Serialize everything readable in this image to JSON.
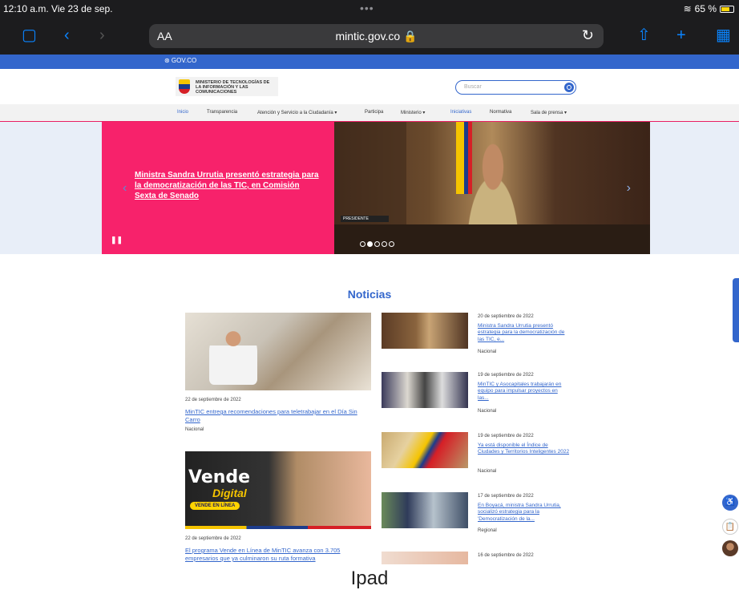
{
  "status_bar": {
    "time": "12:10 a.m.  Vie 23 de sep.",
    "center": "•••",
    "battery": "65 %"
  },
  "safari": {
    "aa": "AA",
    "url": "mintic.gov.co 🔒",
    "icons": [
      "sidebar-icon",
      "back-icon",
      "forward-icon",
      "reload-icon",
      "share-icon",
      "add-tab-icon",
      "tabs-icon"
    ]
  },
  "gov_bar": {
    "label": "⊛ GOV.CO"
  },
  "header": {
    "logo_text": "MINISTERIO DE TECNOLOGÍAS DE LA INFORMACIÓN Y LAS COMUNICACIONES",
    "search_placeholder": "Buscar"
  },
  "nav": [
    "Inicio",
    "Transparencia",
    "Atención y Servicio a la Ciudadanía ▾",
    "Participa",
    "Ministerio ▾",
    "Iniciativas",
    "Normativa",
    "Sala de prensa ▾"
  ],
  "hero": {
    "headline": "Ministra Sandra Urrutia presentó estrategia para la democratización de las TIC, en Comisión Sexta de Senado",
    "plate": "PRESIDENTE",
    "pause": "❚❚",
    "prev": "‹",
    "next": "›"
  },
  "noticias": {
    "title": "Noticias",
    "main": [
      {
        "date": "22 de septiembre de 2022",
        "title": "MinTIC entrega recomendaciones para teletrabajar en el Día Sin Carro",
        "category": "Nacional"
      },
      {
        "date": "22 de septiembre de 2022",
        "title": "El programa Vende en Línea de MinTIC avanza con 3.705 empresarios que ya culminaron su ruta formativa",
        "category": ""
      }
    ],
    "vende": {
      "line1": "Vende",
      "line2": "Digital",
      "line3": "VENDE EN LÍNEA"
    },
    "side": [
      {
        "date": "20 de septiembre de 2022",
        "title": "Ministra Sandra Urrutia presentó estrategia para la democratización de las TIC, e...",
        "category": "Nacional"
      },
      {
        "date": "19 de septiembre de 2022",
        "title": "MinTIC y Asocapitales trabajarán en equipo para impulsar proyectos en las...",
        "category": "Nacional"
      },
      {
        "date": "19 de septiembre de 2022",
        "title": "Ya está disponible el Índice de Ciudades y Territorios Inteligentes 2022",
        "category": "Nacional"
      },
      {
        "date": "17 de septiembre de 2022",
        "title": "En Boyacá, ministra Sandra Urrutia, socializó estrategia para la 'Democratización de la...",
        "category": "Regional"
      },
      {
        "date": "16 de septiembre de 2022",
        "title": "",
        "category": ""
      }
    ]
  },
  "caption": "Ipad",
  "fab": {
    "accessibility": "♿",
    "clipboard": "📋"
  }
}
